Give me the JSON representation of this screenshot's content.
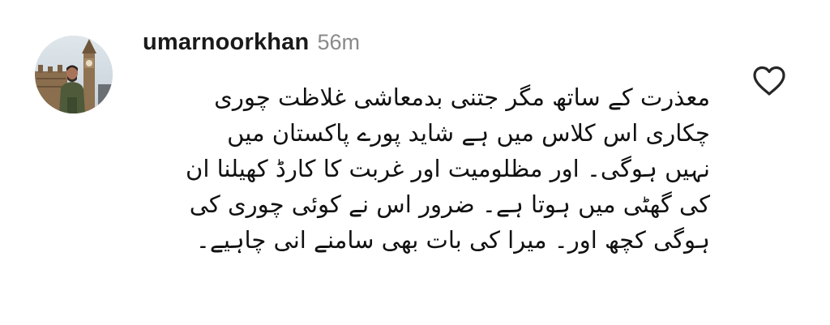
{
  "comment": {
    "avatar_icon": "profile-photo",
    "username": "umarnoorkhan",
    "timestamp": "56m",
    "like_icon": "heart-outline-icon",
    "lines": [
      "معذرت کے ساتھ مگر جتنی بدمعاشی غلاظت چوری",
      "چکاری اس کلاس میں ہے شاید پورے پاکستان میں",
      "نہیں ہوگی۔ اور مظلومیت اور غربت کا کارڈ کھیلنا ان",
      "کی گھٹی میں ہوتا ہے۔  ضرور اس نے کوئی چوری کی",
      "ہوگی کچھ اور۔ میرا کی بات بھی سامنے انی چاہیے۔"
    ]
  },
  "colors": {
    "text": "#111111",
    "timestamp": "#8a8a8a",
    "icon": "#262626",
    "background": "#ffffff"
  }
}
